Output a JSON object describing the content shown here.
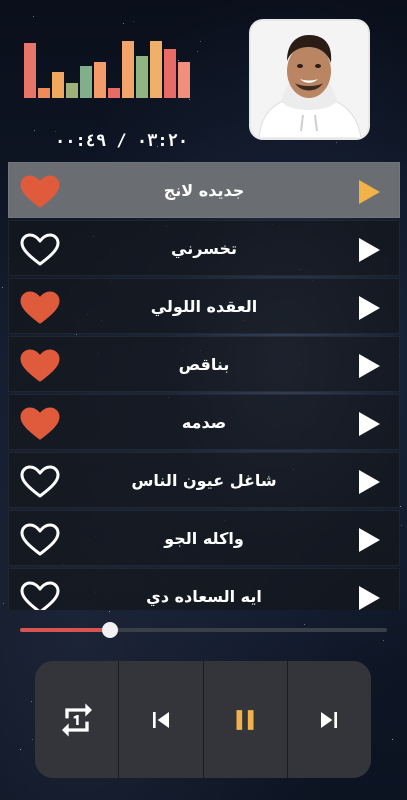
{
  "player": {
    "time_display": "٠٣:٢٠ / ٠٠:٤٩",
    "progress_fraction": 0.245,
    "equalizer_levels": [
      0.95,
      0.18,
      0.45,
      0.25,
      0.55,
      0.62,
      0.18,
      0.98,
      0.72,
      0.98,
      0.85,
      0.62
    ],
    "equalizer_colors": [
      "#e8756a",
      "#ee8a5c",
      "#f0a85e",
      "#9fb07a",
      "#7fb089",
      "#f39b6a",
      "#e86b66",
      "#f2a46a",
      "#8fb584",
      "#f0b06a",
      "#e86b66",
      "#f18e7c"
    ]
  },
  "playlist": [
    {
      "title": "جديده لانج",
      "favorite": true,
      "active": true
    },
    {
      "title": "تخسرني",
      "favorite": false,
      "active": false
    },
    {
      "title": "العقده اللولي",
      "favorite": true,
      "active": false
    },
    {
      "title": "بناقص",
      "favorite": true,
      "active": false
    },
    {
      "title": "صدمه",
      "favorite": true,
      "active": false
    },
    {
      "title": "شاغل عيون الناس",
      "favorite": false,
      "active": false
    },
    {
      "title": "واكله الجو",
      "favorite": false,
      "active": false
    },
    {
      "title": "ايه السعاده دي",
      "favorite": false,
      "active": false
    }
  ],
  "controls": {
    "repeat_icon": "repeat-one-icon",
    "previous_icon": "skip-previous-icon",
    "pause_icon": "pause-icon",
    "next_icon": "skip-next-icon"
  },
  "colors": {
    "heart_fill": "#e05a3c",
    "heart_outline": "#ffffff",
    "play_active": "#f1b24a",
    "play_default": "#ffffff",
    "pause": "#f1b24a",
    "progress_fill": "#d9534f"
  }
}
